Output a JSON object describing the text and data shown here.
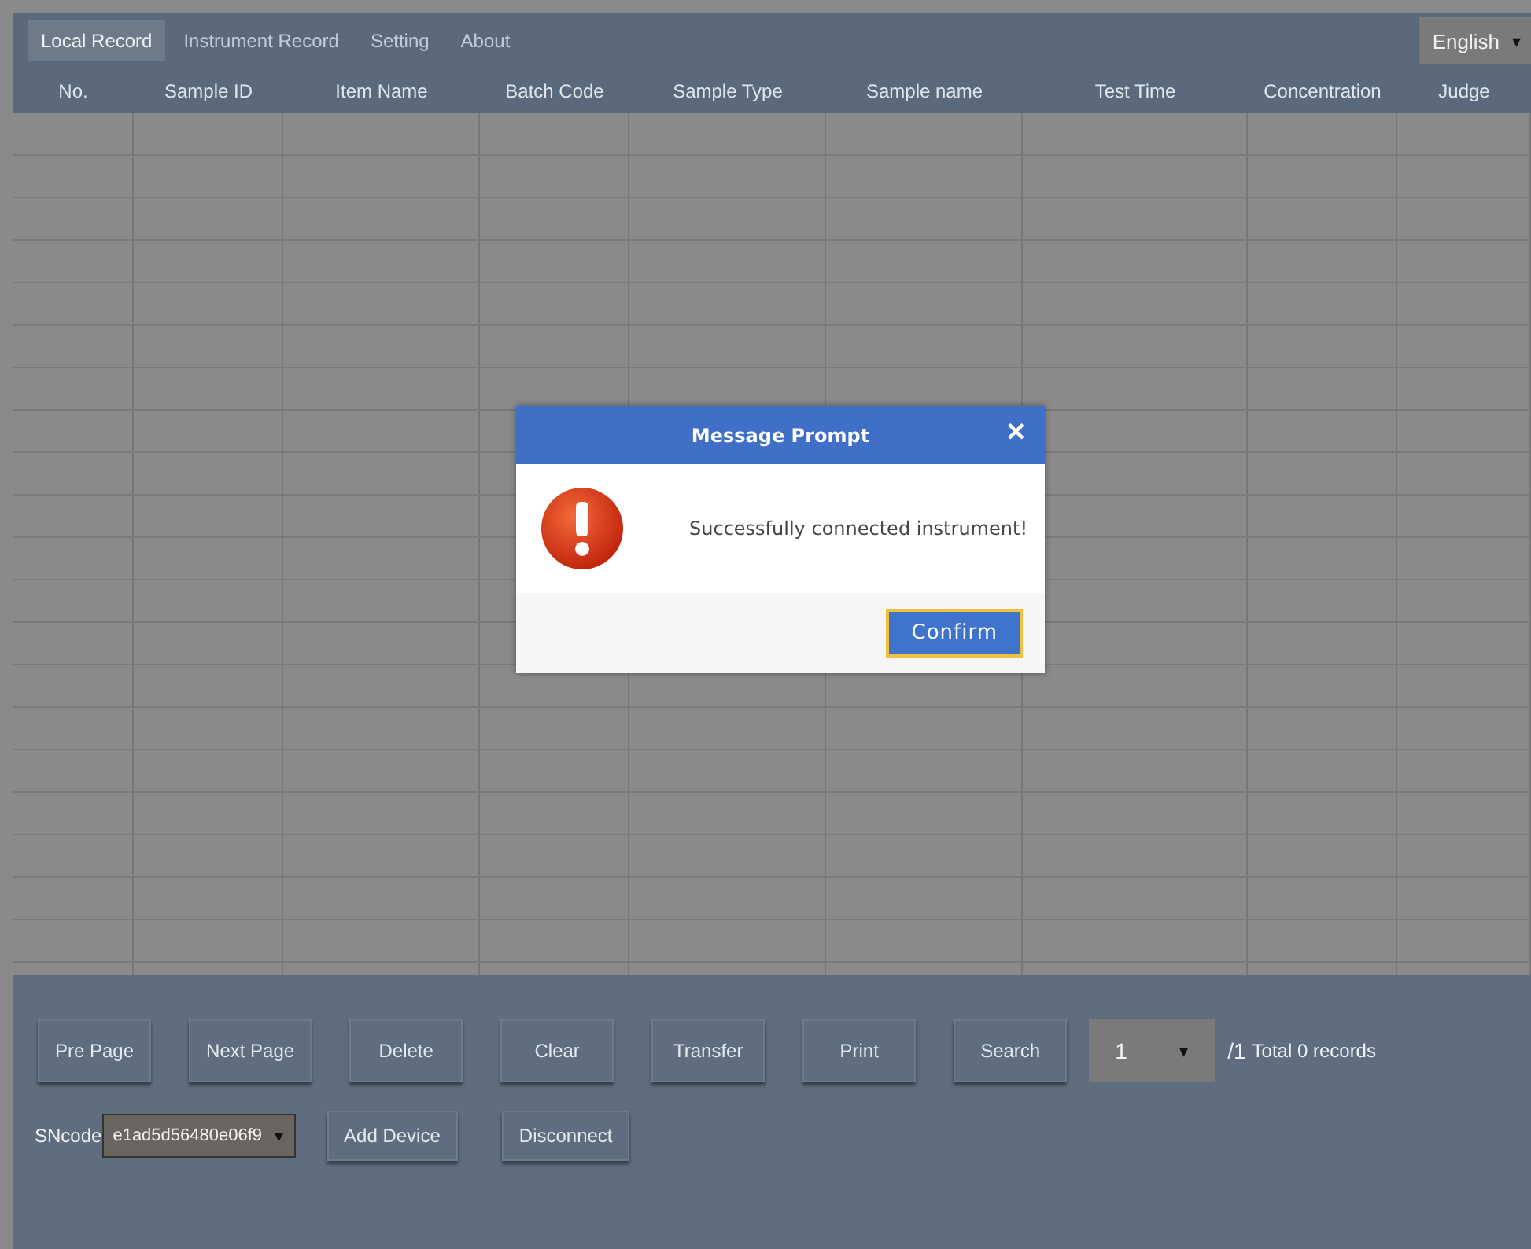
{
  "tabs": [
    {
      "label": "Local Record",
      "selected": true
    },
    {
      "label": "Instrument Record",
      "selected": false
    },
    {
      "label": "Setting",
      "selected": false
    },
    {
      "label": "About",
      "selected": false
    }
  ],
  "language": {
    "value": "English",
    "caret": "▾"
  },
  "table": {
    "columns": [
      "No.",
      "Sample ID",
      "Item Name",
      "Batch Code",
      "Sample Type",
      "Sample name",
      "Test Time",
      "Concentration",
      "Judge"
    ]
  },
  "actions": [
    "Pre Page",
    "Next Page",
    "Delete",
    "Clear",
    "Transfer",
    "Print",
    "Search"
  ],
  "pagination": {
    "page": "1",
    "caret": "▾",
    "total": "/1",
    "records": "Total 0 records"
  },
  "device": {
    "label": "SNcode",
    "value": "e1ad5d56480e06f9",
    "caret": "▾",
    "buttons": [
      "Add Device",
      "Disconnect"
    ]
  },
  "dialog": {
    "title": "Message Prompt",
    "close": "✕",
    "message": "Successfully connected instrument!",
    "button": "Confirm"
  }
}
